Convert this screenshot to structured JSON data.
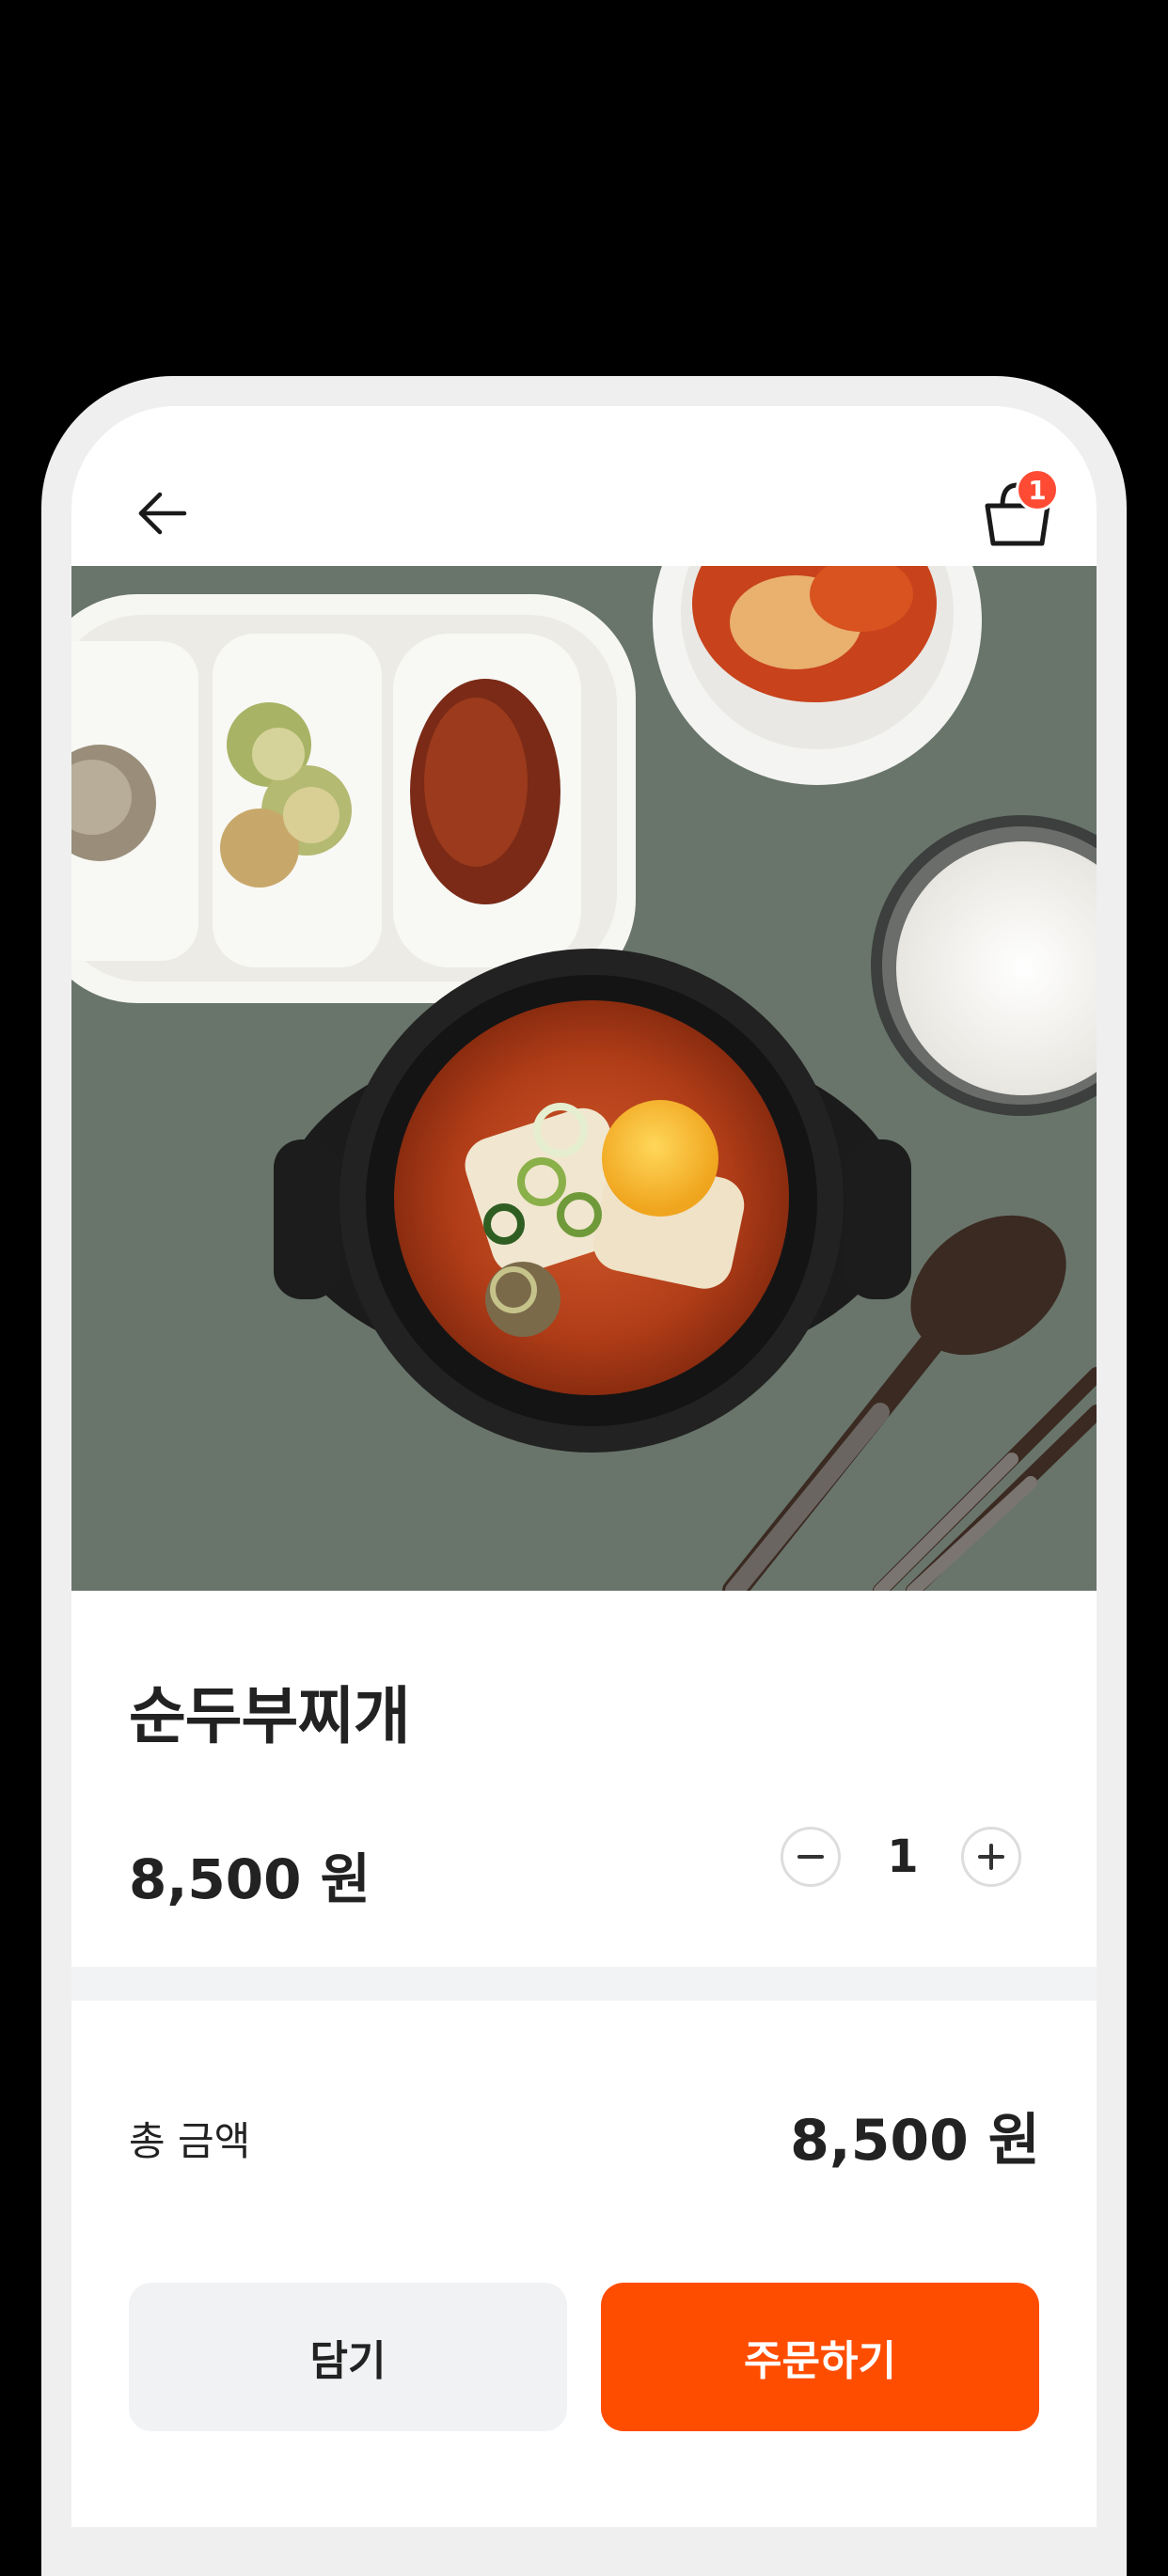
{
  "header": {
    "back_icon": "arrow-left-icon",
    "cart_icon": "shopping-bag-icon",
    "cart_badge": "1",
    "badge_color": "#ff4a34"
  },
  "product": {
    "image_description": "sundubu-jjigae-photo",
    "name": "순두부찌개",
    "price": "8,500 원",
    "quantity": "1",
    "minus_icon": "minus-icon",
    "plus_icon": "plus-icon"
  },
  "summary": {
    "total_label": "총 금액",
    "total_value": "8,500 원"
  },
  "actions": {
    "add_to_cart_label": "담기",
    "order_label": "주문하기",
    "order_color": "#ff4d00"
  }
}
